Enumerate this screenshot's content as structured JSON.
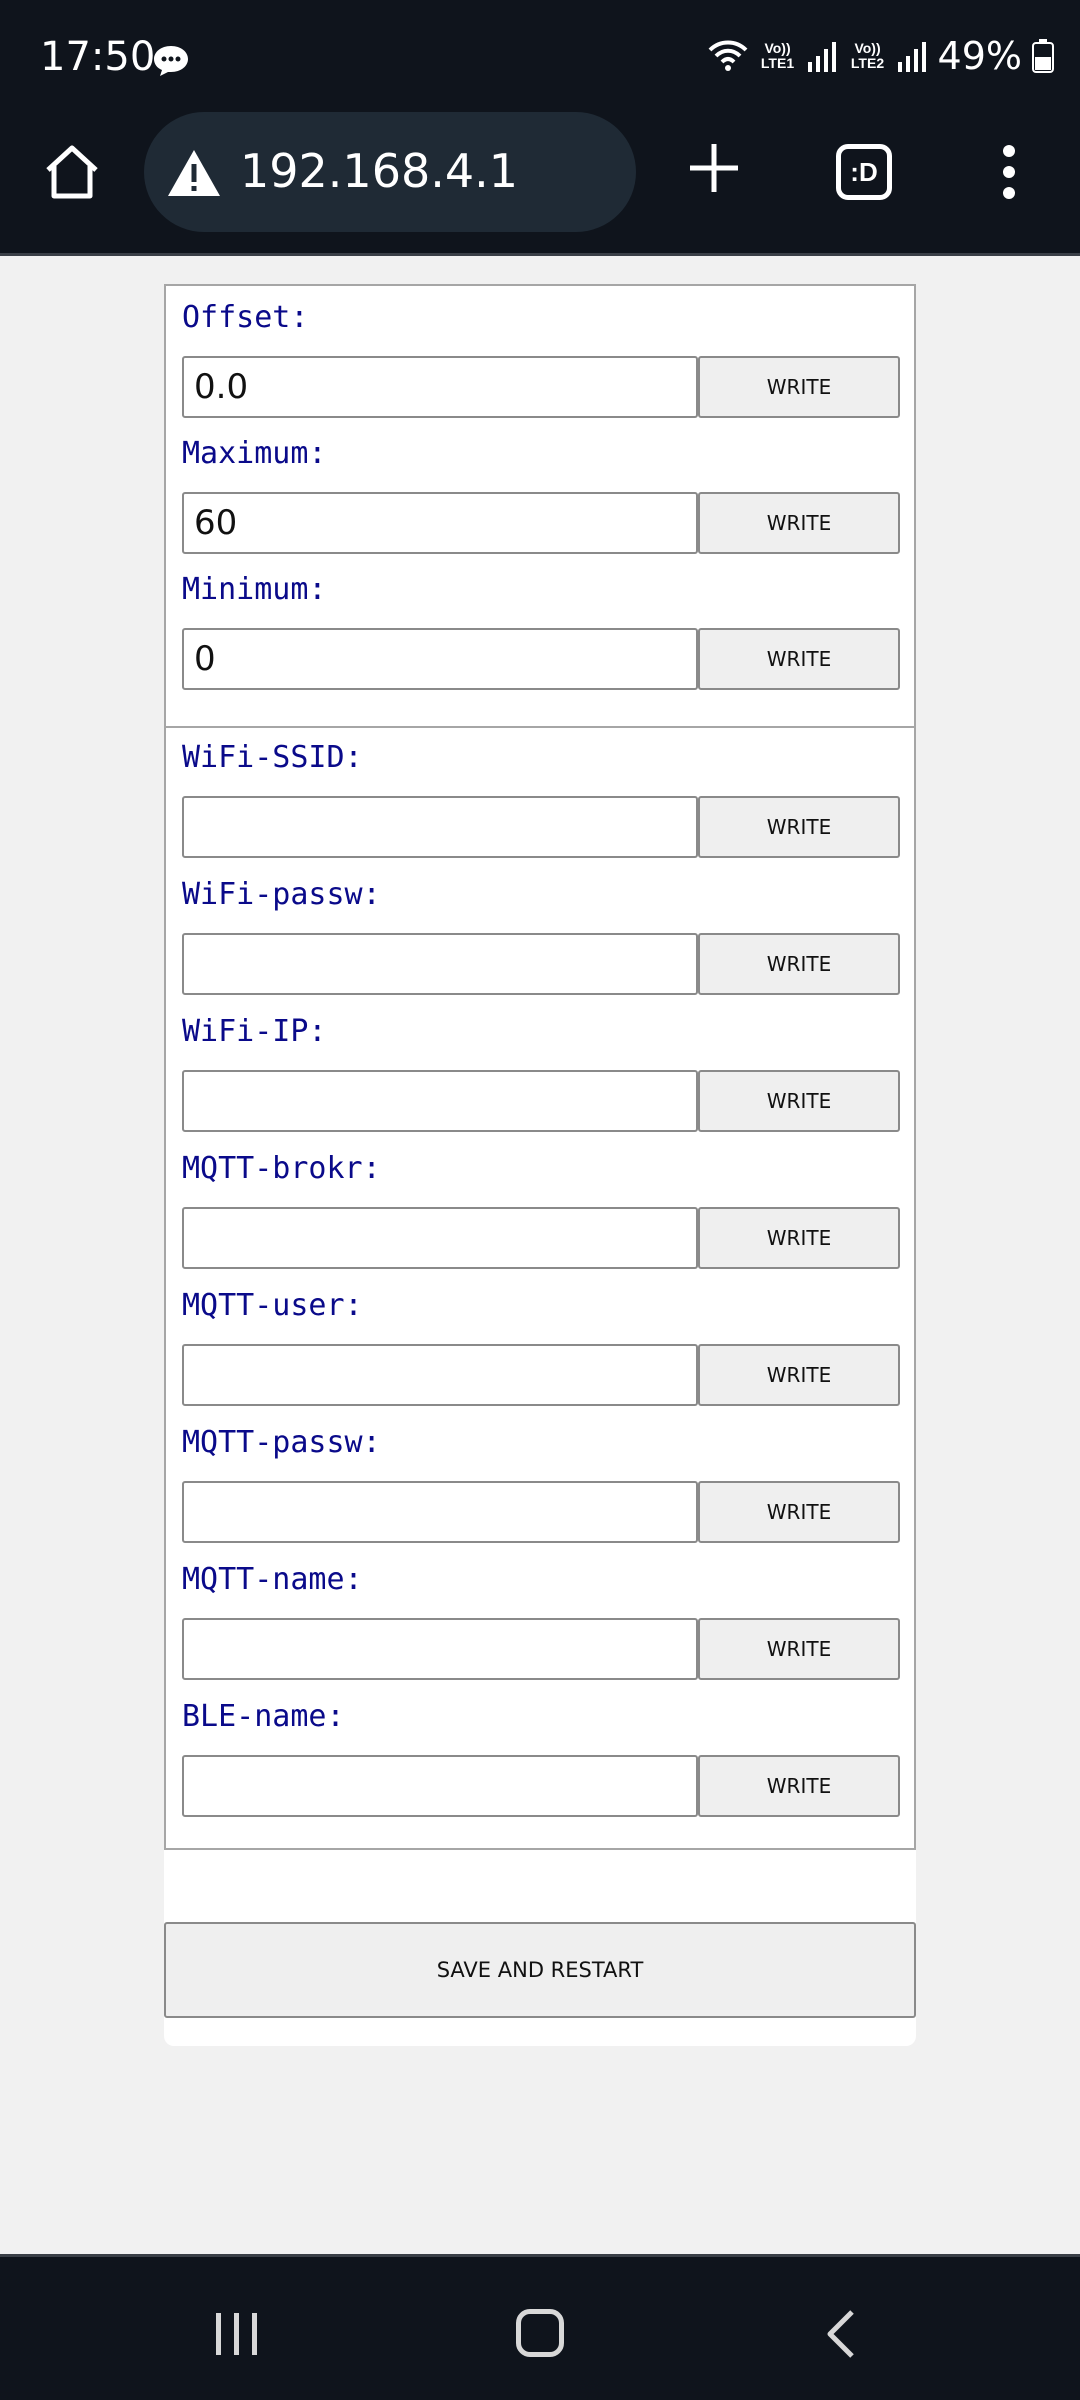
{
  "status_bar": {
    "time": "17:50",
    "message_icon": "chat-bubble-icon",
    "wifi_icon": "wifi-icon",
    "sim1_label": "Vo)) LTE1",
    "sim2_label": "Vo)) LTE2",
    "battery": "49%"
  },
  "browser": {
    "url": "192.168.4.1",
    "security_icon": "warning-triangle-icon",
    "tabs_label": ":D"
  },
  "form": {
    "group1": [
      {
        "label": "Offset:",
        "value": "0.0",
        "button": "WRITE"
      },
      {
        "label": "Maximum:",
        "value": "60",
        "button": "WRITE"
      },
      {
        "label": "Minimum:",
        "value": "0",
        "button": "WRITE"
      }
    ],
    "group2": [
      {
        "label": "WiFi-SSID:",
        "value": "",
        "button": "WRITE"
      },
      {
        "label": "WiFi-passw:",
        "value": "",
        "button": "WRITE"
      },
      {
        "label": "WiFi-IP:",
        "value": "",
        "button": "WRITE"
      },
      {
        "label": "MQTT-brokr:",
        "value": "",
        "button": "WRITE"
      },
      {
        "label": "MQTT-user:",
        "value": "",
        "button": "WRITE"
      },
      {
        "label": "MQTT-passw:",
        "value": "",
        "button": "WRITE"
      },
      {
        "label": "MQTT-name:",
        "value": "",
        "button": "WRITE"
      },
      {
        "label": "BLE-name:",
        "value": "",
        "button": "WRITE"
      }
    ],
    "save_label": "SAVE AND RESTART"
  }
}
